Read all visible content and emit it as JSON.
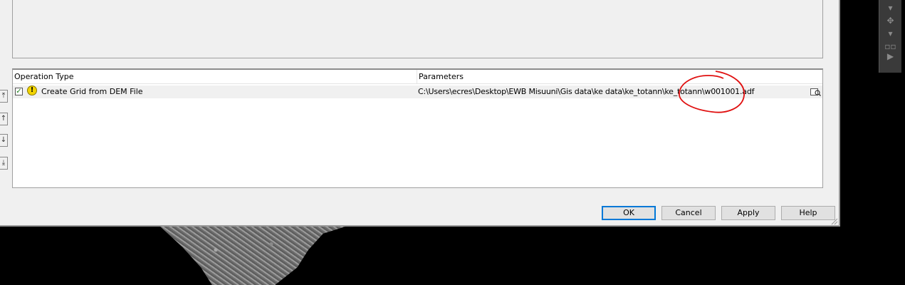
{
  "grid": {
    "header_operation": "Operation Type",
    "header_parameters": "Parameters",
    "rows": [
      {
        "checked": true,
        "operation": "Create Grid from DEM File",
        "parameters": "C:\\Users\\ecres\\Desktop\\EWB Misuuni\\Gis data\\ke data\\ke_totann\\ke_totann\\w001001.adf"
      }
    ]
  },
  "buttons": {
    "ok": "OK",
    "cancel": "Cancel",
    "apply": "Apply",
    "help": "Help"
  },
  "icons": {
    "warning": "warning-icon",
    "browse": "folder-browse-icon",
    "move_top": "move-top-icon",
    "move_up": "move-up-icon",
    "move_down": "move-down-icon",
    "move_bottom": "move-bottom-icon"
  },
  "colors": {
    "annotation_circle": "#e01010",
    "default_button_border": "#0078d7",
    "check": "#1a7f1a",
    "warning": "#f2d400"
  }
}
